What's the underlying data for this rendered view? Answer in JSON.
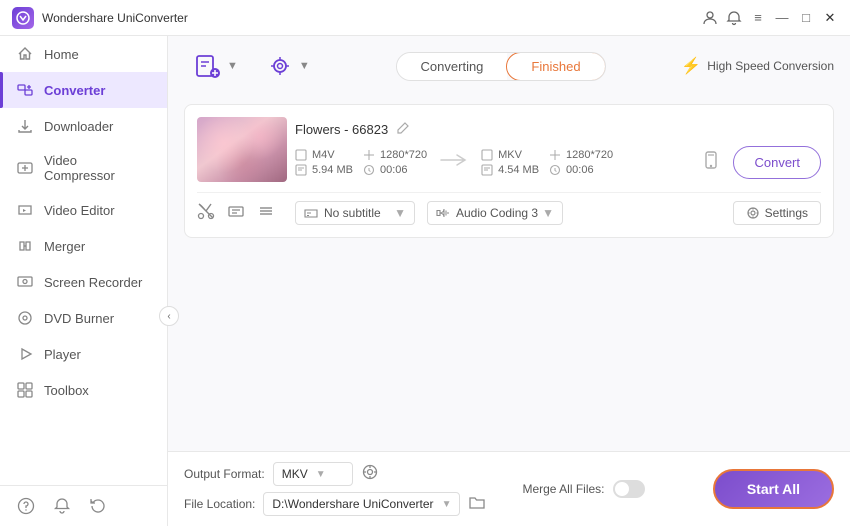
{
  "app": {
    "title": "Wondershare UniConverter",
    "logo_text": "W"
  },
  "titlebar": {
    "controls": {
      "user_icon": "👤",
      "bell_icon": "🔔",
      "menu_icon": "≡",
      "minimize_icon": "—",
      "maximize_icon": "□",
      "close_icon": "✕"
    }
  },
  "sidebar": {
    "items": [
      {
        "id": "home",
        "label": "Home",
        "icon": "⌂"
      },
      {
        "id": "converter",
        "label": "Converter",
        "icon": "⇄",
        "active": true
      },
      {
        "id": "downloader",
        "label": "Downloader",
        "icon": "↓"
      },
      {
        "id": "video-compressor",
        "label": "Video Compressor",
        "icon": "⊞"
      },
      {
        "id": "video-editor",
        "label": "Video Editor",
        "icon": "✂"
      },
      {
        "id": "merger",
        "label": "Merger",
        "icon": "⊕"
      },
      {
        "id": "screen-recorder",
        "label": "Screen Recorder",
        "icon": "⬡"
      },
      {
        "id": "dvd-burner",
        "label": "DVD Burner",
        "icon": "◉"
      },
      {
        "id": "player",
        "label": "Player",
        "icon": "▶"
      },
      {
        "id": "toolbox",
        "label": "Toolbox",
        "icon": "⊞"
      }
    ],
    "footer_icons": [
      "?",
      "🔔",
      "↺"
    ]
  },
  "toolbar": {
    "add_btn_icon": "📄+",
    "settings_btn_icon": "⚙",
    "tabs": [
      {
        "id": "converting",
        "label": "Converting"
      },
      {
        "id": "finished",
        "label": "Finished",
        "active": true
      }
    ],
    "speed_label": "High Speed Conversion",
    "speed_icon": "⚡"
  },
  "file": {
    "name": "Flowers - 66823",
    "edit_icon": "✎",
    "source": {
      "format": "M4V",
      "resolution": "1280*720",
      "size": "5.94 MB",
      "duration": "00:06"
    },
    "target": {
      "format": "MKV",
      "resolution": "1280*720",
      "size": "4.54 MB",
      "duration": "00:06"
    },
    "arrow": "→",
    "convert_btn_label": "Convert",
    "device_icon": "📱",
    "subtitle_label": "No subtitle",
    "audio_label": "Audio Coding 3",
    "settings_label": "Settings",
    "settings_icon": "⚙",
    "action_icons": {
      "cut": "✂",
      "caption": "⊡",
      "menu": "≡"
    }
  },
  "bottom": {
    "output_format_label": "Output Format:",
    "output_format_value": "MKV",
    "output_format_icon": "▼",
    "output_settings_icon": "⚙",
    "merge_files_label": "Merge All Files:",
    "file_location_label": "File Location:",
    "file_location_value": "D:\\Wondershare UniConverter",
    "file_location_icon": "▼",
    "folder_icon": "📁",
    "start_all_label": "Start All"
  }
}
